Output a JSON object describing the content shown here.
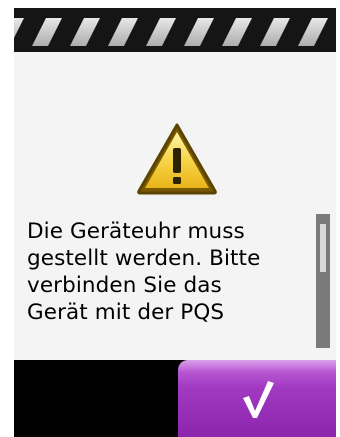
{
  "header": {
    "icon": "striped-header-bar"
  },
  "dialog": {
    "icon": "warning-triangle-icon",
    "message_lines": [
      "Die Geräteuhr muss",
      "gestellt werden. Bitte",
      "verbinden Sie das",
      "Gerät mit der PQS"
    ]
  },
  "footer": {
    "confirm_icon": "checkmark-icon"
  },
  "colors": {
    "accent": "#9b32bd",
    "panel": "#f4f4f4",
    "warning": "#f2c230"
  }
}
